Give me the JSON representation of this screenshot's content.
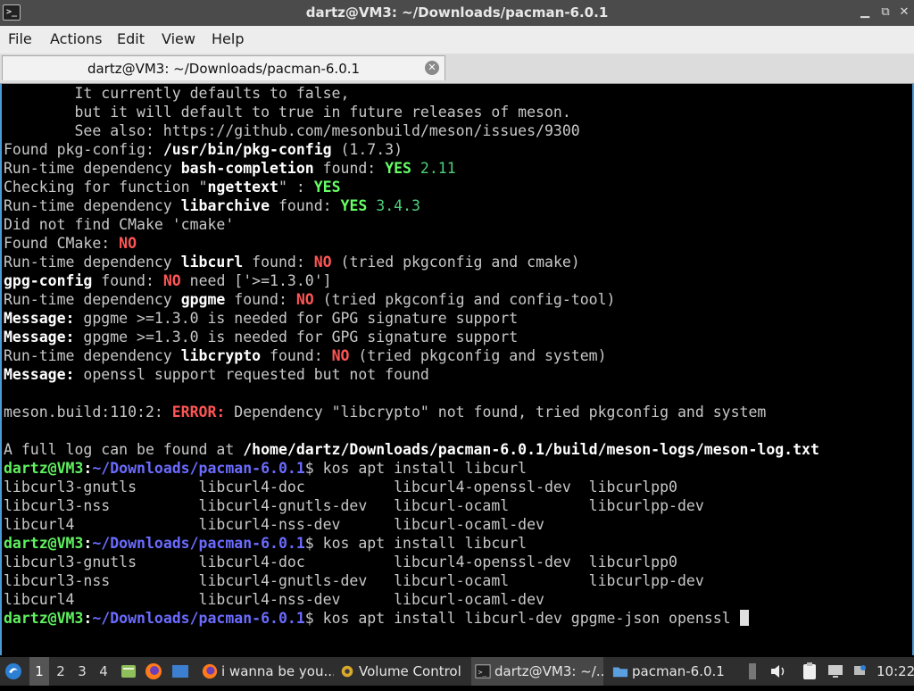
{
  "window": {
    "title": "dartz@VM3: ~/Downloads/pacman-6.0.1",
    "app_icon": "terminal-icon"
  },
  "menu": [
    "File",
    "Actions",
    "Edit",
    "View",
    "Help"
  ],
  "tab": {
    "label": "dartz@VM3: ~/Downloads/pacman-6.0.1",
    "close_icon": "close-icon"
  },
  "terminal": {
    "lines": [
      [
        {
          "t": "        It currently defaults to false,"
        }
      ],
      [
        {
          "t": "        but it will default to true in future releases of meson."
        }
      ],
      [
        {
          "t": "        See also: https://github.com/mesonbuild/meson/issues/9300"
        }
      ],
      [
        {
          "t": "Found pkg-config: "
        },
        {
          "t": "/usr/bin/pkg-config",
          "c": "b"
        },
        {
          "t": " (1.7.3)"
        }
      ],
      [
        {
          "t": "Run-time dependency "
        },
        {
          "t": "bash-completion",
          "c": "b"
        },
        {
          "t": " found: "
        },
        {
          "t": "YES",
          "c": "gb"
        },
        {
          "t": " 2.11",
          "c": "green"
        }
      ],
      [
        {
          "t": "Checking for function \""
        },
        {
          "t": "ngettext",
          "c": "b"
        },
        {
          "t": "\" : "
        },
        {
          "t": "YES",
          "c": "gb"
        }
      ],
      [
        {
          "t": "Run-time dependency "
        },
        {
          "t": "libarchive",
          "c": "b"
        },
        {
          "t": " found: "
        },
        {
          "t": "YES",
          "c": "gb"
        },
        {
          "t": " 3.4.3",
          "c": "green"
        }
      ],
      [
        {
          "t": "Did not find CMake 'cmake'"
        }
      ],
      [
        {
          "t": "Found CMake: "
        },
        {
          "t": "NO",
          "c": "rb"
        }
      ],
      [
        {
          "t": "Run-time dependency "
        },
        {
          "t": "libcurl",
          "c": "b"
        },
        {
          "t": " found: "
        },
        {
          "t": "NO",
          "c": "rb"
        },
        {
          "t": " (tried pkgconfig and cmake)"
        }
      ],
      [
        {
          "t": "gpg-config",
          "c": "b"
        },
        {
          "t": " found: "
        },
        {
          "t": "NO",
          "c": "rb"
        },
        {
          "t": " need ['>=1.3.0']"
        }
      ],
      [
        {
          "t": "Run-time dependency "
        },
        {
          "t": "gpgme",
          "c": "b"
        },
        {
          "t": " found: "
        },
        {
          "t": "NO",
          "c": "rb"
        },
        {
          "t": " (tried pkgconfig and config-tool)"
        }
      ],
      [
        {
          "t": "Message:",
          "c": "b"
        },
        {
          "t": " gpgme >=1.3.0 is needed for GPG signature support"
        }
      ],
      [
        {
          "t": "Message:",
          "c": "b"
        },
        {
          "t": " gpgme >=1.3.0 is needed for GPG signature support"
        }
      ],
      [
        {
          "t": "Run-time dependency "
        },
        {
          "t": "libcrypto",
          "c": "b"
        },
        {
          "t": " found: "
        },
        {
          "t": "NO",
          "c": "rb"
        },
        {
          "t": " (tried pkgconfig and system)"
        }
      ],
      [
        {
          "t": "Message:",
          "c": "b"
        },
        {
          "t": " openssl support requested but not found"
        }
      ],
      [],
      [
        {
          "t": "meson.build:110:2: "
        },
        {
          "t": "ERROR:",
          "c": "rb"
        },
        {
          "t": " Dependency \"libcrypto\" not found, tried pkgconfig and system"
        }
      ],
      [],
      [
        {
          "t": "A full log can be found at "
        },
        {
          "t": "/home/dartz/Downloads/pacman-6.0.1/build/meson-logs/meson-log.txt",
          "c": "b"
        }
      ],
      [
        {
          "t": "dartz@VM3",
          "c": "user"
        },
        {
          "t": ":",
          "c": "b"
        },
        {
          "t": "~/Downloads/pacman-6.0.1",
          "c": "path"
        },
        {
          "t": "$ kos apt install libcurl"
        }
      ],
      [
        {
          "t": "libcurl3-gnutls       libcurl4-doc          libcurl4-openssl-dev  libcurlpp0"
        }
      ],
      [
        {
          "t": "libcurl3-nss          libcurl4-gnutls-dev   libcurl-ocaml         libcurlpp-dev"
        }
      ],
      [
        {
          "t": "libcurl4              libcurl4-nss-dev      libcurl-ocaml-dev"
        }
      ],
      [
        {
          "t": "dartz@VM3",
          "c": "user"
        },
        {
          "t": ":",
          "c": "b"
        },
        {
          "t": "~/Downloads/pacman-6.0.1",
          "c": "path"
        },
        {
          "t": "$ kos apt install libcurl"
        }
      ],
      [
        {
          "t": "libcurl3-gnutls       libcurl4-doc          libcurl4-openssl-dev  libcurlpp0"
        }
      ],
      [
        {
          "t": "libcurl3-nss          libcurl4-gnutls-dev   libcurl-ocaml         libcurlpp-dev"
        }
      ],
      [
        {
          "t": "libcurl4              libcurl4-nss-dev      libcurl-ocaml-dev"
        }
      ],
      [
        {
          "t": "dartz@VM3",
          "c": "user"
        },
        {
          "t": ":",
          "c": "b"
        },
        {
          "t": "~/Downloads/pacman-6.0.1",
          "c": "path"
        },
        {
          "t": "$ kos apt install libcurl-dev gpgme-json openssl "
        },
        {
          "t": "",
          "c": "cursor"
        }
      ]
    ]
  },
  "taskbar": {
    "start_icon": "menu-logo-icon",
    "workspaces": [
      "1",
      "2",
      "3",
      "4"
    ],
    "active_workspace": "1",
    "launchers": [
      "file-manager-icon",
      "firefox-icon",
      "desktop-icon"
    ],
    "tasks": [
      {
        "label": "i wanna be you...",
        "icon": "firefox-icon"
      },
      {
        "label": "Volume Control",
        "icon": "volume-control-icon"
      },
      {
        "label": "dartz@VM3: ~/...",
        "icon": "terminal-icon",
        "active": true
      },
      {
        "label": "pacman-6.0.1",
        "icon": "folder-icon"
      }
    ],
    "tray_icons": [
      "scroll-icon",
      "speaker-icon",
      "clipboard-icon",
      "display-icon",
      "network-icon"
    ],
    "clock": "10:22"
  }
}
